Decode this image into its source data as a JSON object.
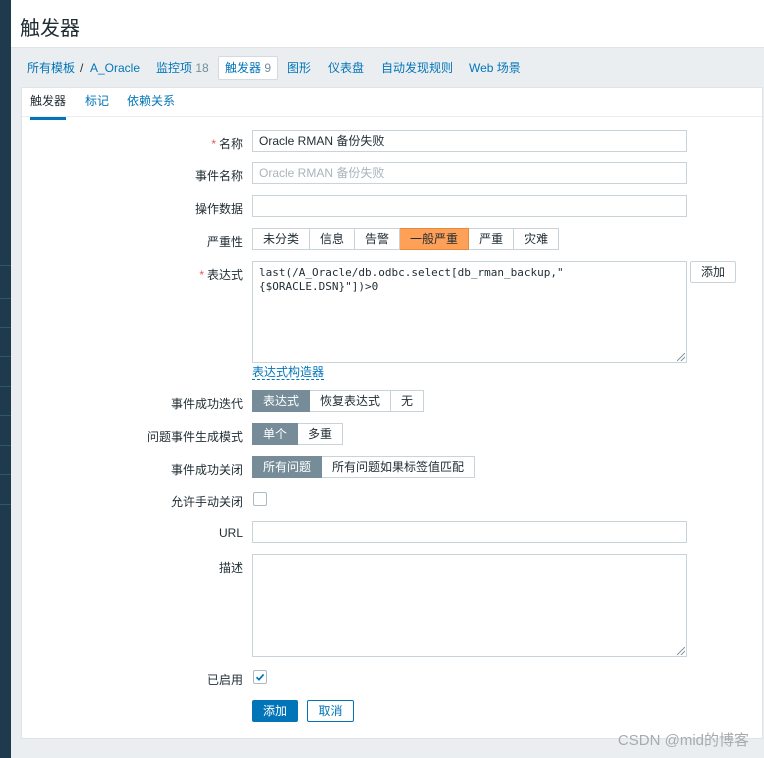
{
  "page": {
    "title": "触发器"
  },
  "breadcrumb": {
    "all_templates": "所有模板",
    "separator": "/",
    "host": "A_Oracle",
    "items_label": "监控项",
    "items_count": "18",
    "triggers_label": "触发器",
    "triggers_count": "9",
    "graphs": "图形",
    "dashboards": "仪表盘",
    "discovery": "自动发现规则",
    "web": "Web 场景"
  },
  "tabs": {
    "trigger": "触发器",
    "tags": "标记",
    "dependencies": "依赖关系"
  },
  "form": {
    "name_label": "名称",
    "name_value": "Oracle RMAN 备份失败",
    "event_name_label": "事件名称",
    "event_name_placeholder": "Oracle RMAN 备份失败",
    "opdata_label": "操作数据",
    "opdata_value": "",
    "severity_label": "严重性",
    "severity_options": [
      "未分类",
      "信息",
      "告警",
      "一般严重",
      "严重",
      "灾难"
    ],
    "severity_selected": "一般严重",
    "expression_label": "表达式",
    "expression_line1": "last(/A_Oracle/db.odbc.select[db_rman_backup,\"",
    "expression_line2": "{$ORACLE.DSN}\"])>0",
    "add_button": "添加",
    "expression_constructor": "表达式构造器",
    "ok_event_gen_label": "事件成功迭代",
    "ok_event_gen_options": [
      "表达式",
      "恢复表达式",
      "无"
    ],
    "ok_event_gen_selected": "表达式",
    "problem_mode_label": "问题事件生成模式",
    "problem_mode_options": [
      "单个",
      "多重"
    ],
    "problem_mode_selected": "单个",
    "ok_close_label": "事件成功关闭",
    "ok_close_options": [
      "所有问题",
      "所有问题如果标签值匹配"
    ],
    "ok_close_selected": "所有问题",
    "manual_close_label": "允许手动关闭",
    "manual_close_checked": false,
    "url_label": "URL",
    "url_value": "",
    "description_label": "描述",
    "description_value": "",
    "enabled_label": "已启用",
    "enabled_checked": true,
    "submit_button": "添加",
    "cancel_button": "取消"
  },
  "watermark": "CSDN @mid的博客",
  "colors": {
    "accent": "#0275b8",
    "severity_average": "#ffa059",
    "selected_gray": "#768d99"
  }
}
